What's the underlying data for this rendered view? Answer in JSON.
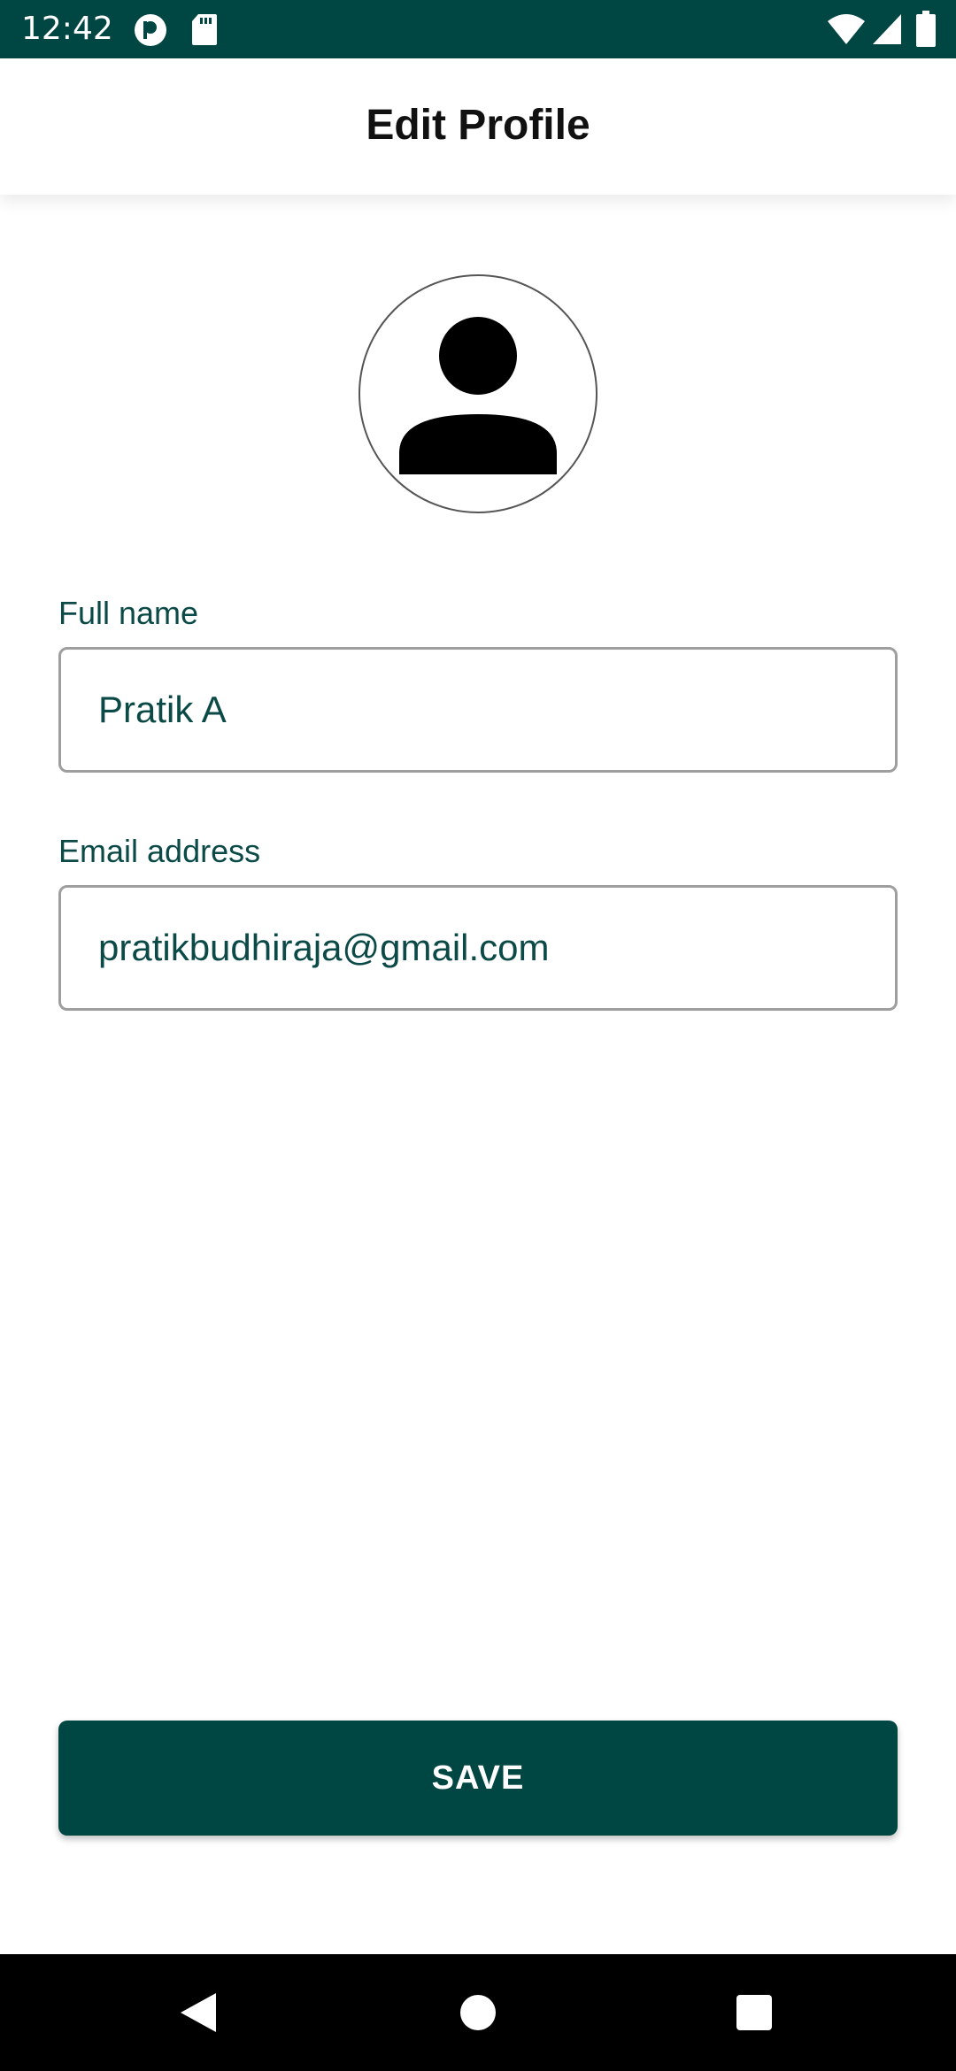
{
  "status_bar": {
    "time": "12:42",
    "icons": [
      "app-notification-icon",
      "sd-card-icon",
      "wifi-icon",
      "cell-signal-icon",
      "battery-icon"
    ]
  },
  "header": {
    "title": "Edit Profile"
  },
  "profile": {
    "avatar_icon": "person-icon"
  },
  "form": {
    "full_name": {
      "label": "Full name",
      "value": "Pratik A"
    },
    "email": {
      "label": "Email address",
      "value": "pratikbudhiraja@gmail.com"
    }
  },
  "actions": {
    "save_label": "SAVE"
  },
  "nav_bar": {
    "icons": [
      "back-icon",
      "home-icon",
      "recents-icon"
    ]
  },
  "colors": {
    "primary": "#004643",
    "text_primary": "#0b4a47",
    "title": "#111111",
    "input_border": "#9e9e9e",
    "background": "#ffffff"
  }
}
